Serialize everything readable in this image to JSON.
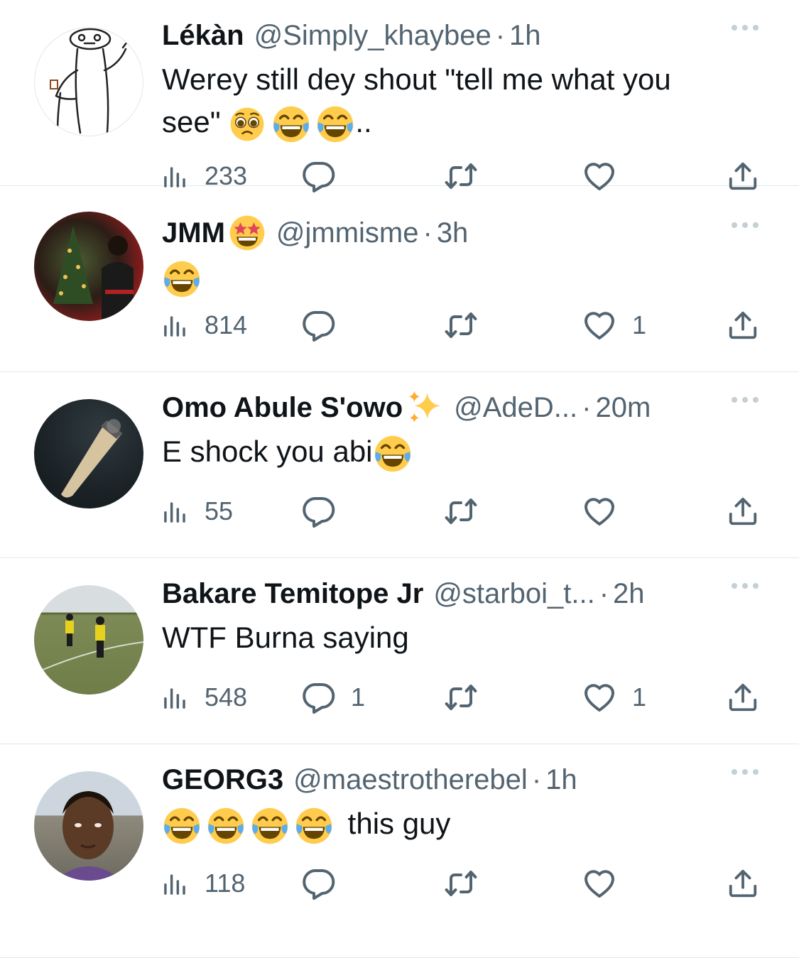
{
  "tweets": [
    {
      "name": "Lékàn",
      "handle": "@Simply_khaybee",
      "separator": "·",
      "time": "1h",
      "text": "Werey still dey shout \"tell me what you see\" 🥺😂😂..",
      "text_line1": "Werey still dey shout \"tell me what you",
      "text_line2_prefix": "see\"",
      "text_line2_suffix": "..",
      "name_badge": "",
      "views": "233",
      "replies": "",
      "retweets": "",
      "likes": ""
    },
    {
      "name": "JMM",
      "name_badge": "🤩",
      "handle": "@jmmisme",
      "separator": "·",
      "time": "3h",
      "text": "😂",
      "views": "814",
      "replies": "",
      "retweets": "",
      "likes": "1"
    },
    {
      "name": "Omo Abule S'owo",
      "name_badge": "✨",
      "handle": "@AdeD...",
      "separator": "·",
      "time": "20m",
      "text": "E shock you abi😂",
      "text_plain": "E shock you abi",
      "views": "55",
      "replies": "",
      "retweets": "",
      "likes": ""
    },
    {
      "name": "Bakare Temitope Jr",
      "handle": "@starboi_t...",
      "separator": "·",
      "time": "2h",
      "text": "WTF Burna saying",
      "views": "548",
      "replies": "1",
      "retweets": "",
      "likes": "1"
    },
    {
      "name": "GEORG3",
      "handle": "@maestrotherebel",
      "separator": "·",
      "time": "1h",
      "text": "😂😂😂😂 this guy",
      "text_plain": "this guy",
      "views": "118",
      "replies": "",
      "retweets": "",
      "likes": ""
    }
  ],
  "icons": {
    "views": "views-chart-icon",
    "reply": "reply-bubble-icon",
    "retweet": "retweet-icon",
    "like": "heart-icon",
    "share": "share-upload-icon",
    "more": "more-options-icon"
  },
  "colors": {
    "text": "#0f1419",
    "secondary": "#536471",
    "divider": "#e2e6e9"
  }
}
